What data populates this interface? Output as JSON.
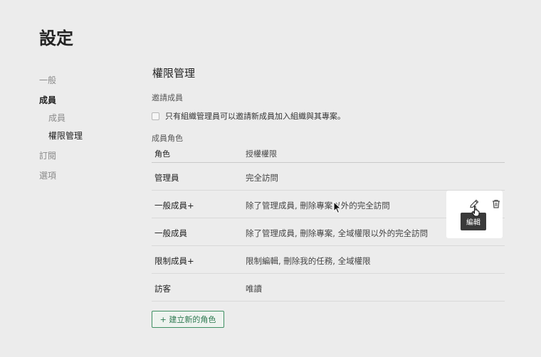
{
  "page": {
    "title": "設定"
  },
  "sidebar": {
    "items": [
      {
        "label": "一般"
      },
      {
        "label": "成員"
      },
      {
        "label": "成員"
      },
      {
        "label": "權限管理"
      },
      {
        "label": "訂閱"
      },
      {
        "label": "選項"
      }
    ]
  },
  "main": {
    "section_title": "權限管理",
    "invite_label": "邀請成員",
    "invite_option": "只有組織管理員可以邀請新成員加入組織與其專案。",
    "roles_label": "成員角色",
    "table": {
      "headers": [
        "角色",
        "授權權限"
      ],
      "rows": [
        {
          "role": "管理員",
          "permission": "完全訪問"
        },
        {
          "role": "一般成員+",
          "permission": "除了管理成員, 刪除專案以外的完全訪問"
        },
        {
          "role": "一般成員",
          "permission": "除了管理成員, 刪除專案, 全域權限以外的完全訪問"
        },
        {
          "role": "限制成員+",
          "permission": "限制編輯, 刪除我的任務, 全域權限"
        },
        {
          "role": "訪客",
          "permission": "唯讀"
        }
      ]
    },
    "tooltip": "編輯",
    "add_role_button": "+ 建立新的角色"
  },
  "icons": {
    "edit": "pencil-icon",
    "delete": "trash-icon",
    "cursor": "mouse-pointer-icon"
  },
  "colors": {
    "accent": "#3f8f62",
    "background": "#ececec"
  }
}
